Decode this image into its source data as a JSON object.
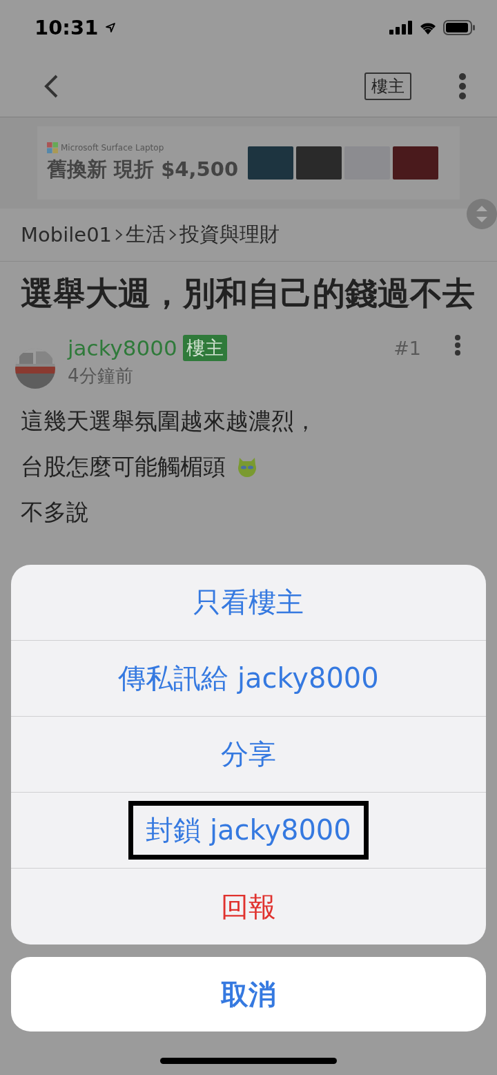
{
  "status_bar": {
    "time": "10:31"
  },
  "nav": {
    "op_filter_label": "樓主"
  },
  "ad": {
    "brand": "Microsoft Surface Laptop",
    "headline": "舊換新 現折 $4,500",
    "swatches": [
      {
        "color": "#1d3440"
      },
      {
        "color": "#2a2a2a"
      },
      {
        "color": "#8c8c90"
      },
      {
        "color": "#4a1a1c"
      }
    ]
  },
  "breadcrumb": [
    "Mobile01",
    "生活",
    "投資與理財"
  ],
  "thread_title": "選舉大週，別和自己的錢過不去",
  "post": {
    "author": "jacky8000",
    "badge": "樓主",
    "time": "4分鐘前",
    "floor": "#1",
    "lines": [
      "這幾天選舉氛圍越來越濃烈，",
      "台股怎麼可能觸楣頭",
      "不多說"
    ]
  },
  "action_sheet": {
    "items": [
      {
        "label": "只看樓主",
        "kind": "normal",
        "highlighted": false
      },
      {
        "label": "傳私訊給 jacky8000",
        "kind": "normal",
        "highlighted": false
      },
      {
        "label": "分享",
        "kind": "normal",
        "highlighted": false
      },
      {
        "label": "封鎖 jacky8000",
        "kind": "normal",
        "highlighted": true
      },
      {
        "label": "回報",
        "kind": "destructive",
        "highlighted": false
      }
    ],
    "cancel": "取消"
  }
}
